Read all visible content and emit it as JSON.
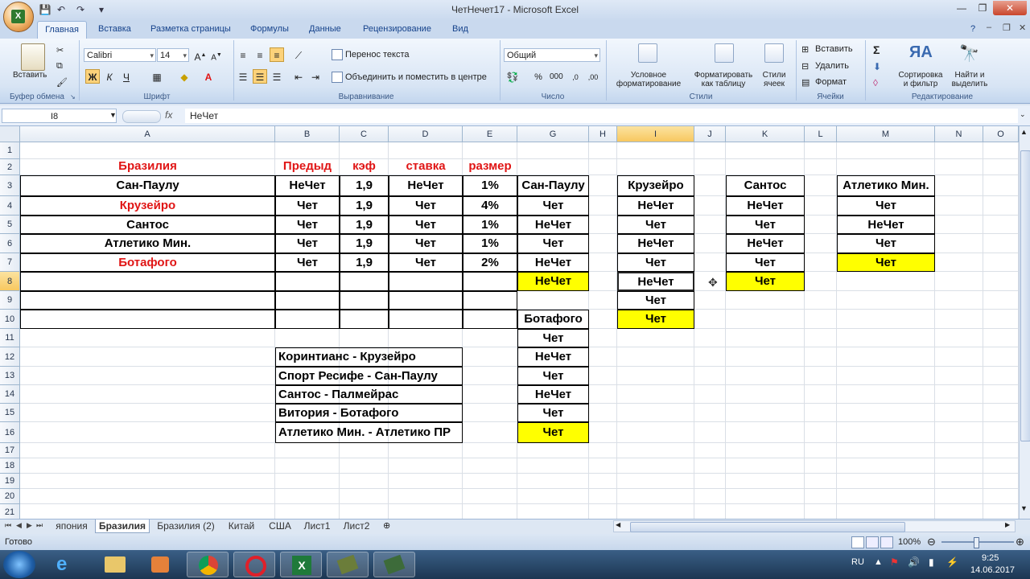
{
  "window": {
    "title": "ЧетНечет17 - Microsoft Excel"
  },
  "tabs": [
    "Главная",
    "Вставка",
    "Разметка страницы",
    "Формулы",
    "Данные",
    "Рецензирование",
    "Вид"
  ],
  "ribbon": {
    "paste_label": "Вставить",
    "font_name": "Calibri",
    "font_size": "14",
    "wrap_text": "Перенос текста",
    "merge_center": "Объединить и поместить в центре",
    "number_format": "Общий",
    "cond_format": [
      "Условное",
      "форматирование"
    ],
    "format_table": [
      "Форматировать",
      "как таблицу"
    ],
    "cell_styles": [
      "Стили",
      "ячеек"
    ],
    "insert": "Вставить",
    "delete": "Удалить",
    "format": "Формат",
    "sort_filter": [
      "Сортировка",
      "и фильтр"
    ],
    "find_select": [
      "Найти и",
      "выделить"
    ],
    "groups": [
      "Буфер обмена",
      "Шрифт",
      "Выравнивание",
      "Число",
      "Стили",
      "Ячейки",
      "Редактирование"
    ]
  },
  "formula_bar": {
    "name_box": "I8",
    "fx": "fx",
    "content": "НеЧет"
  },
  "columns": [
    "A",
    "B",
    "C",
    "D",
    "E",
    "G",
    "H",
    "I",
    "J",
    "K",
    "L",
    "M",
    "N",
    "O"
  ],
  "rows": [
    "1",
    "2",
    "3",
    "4",
    "5",
    "6",
    "7",
    "8",
    "9",
    "10",
    "11",
    "12",
    "13",
    "14",
    "15",
    "16",
    "17",
    "18",
    "19",
    "20",
    "21"
  ],
  "table_main": {
    "headers": [
      "Бразилия",
      "Предыд",
      "кэф",
      "ставка",
      "размер"
    ],
    "rows": [
      [
        "Сан-Паулу",
        "НеЧет",
        "1,9",
        "НеЧет",
        "1%"
      ],
      [
        "Крузейро",
        "Чет",
        "1,9",
        "Чет",
        "4%"
      ],
      [
        "Сантос",
        "Чет",
        "1,9",
        "Чет",
        "1%"
      ],
      [
        "Атлетико Мин.",
        "Чет",
        "1,9",
        "Чет",
        "1%"
      ],
      [
        "Ботафого",
        "Чет",
        "1,9",
        "Чет",
        "2%"
      ]
    ]
  },
  "matches": [
    "Коринтианс - Крузейро",
    "Спорт Ресифе - Сан-Паулу",
    "Сантос - Палмейрас",
    "Витория - Ботафого",
    "Атлетико Мин. - Атлетико ПР"
  ],
  "col_g_top": [
    "Сан-Паулу",
    "Чет",
    "НеЧет",
    "Чет",
    "НеЧет",
    "НеЧет"
  ],
  "col_g_bottom": [
    "Ботафого",
    "Чет",
    "НеЧет",
    "Чет",
    "НеЧет",
    "Чет",
    "Чет"
  ],
  "col_i": [
    "Крузейро",
    "НеЧет",
    "Чет",
    "НеЧет",
    "Чет",
    "НеЧет",
    "Чет",
    "Чет"
  ],
  "col_k": [
    "Сантос",
    "НеЧет",
    "Чет",
    "НеЧет",
    "Чет",
    "Чет"
  ],
  "col_m": [
    "Атлетико Мин.",
    "Чет",
    "НеЧет",
    "Чет",
    "Чет"
  ],
  "sheets": [
    "япония",
    "Бразилия",
    "Бразилия (2)",
    "Китай",
    "США",
    "Лист1",
    "Лист2"
  ],
  "status": {
    "ready": "Готово",
    "zoom": "100%"
  },
  "taskbar": {
    "lang": "RU",
    "time": "9:25",
    "date": "14.06.2017"
  },
  "colors": {
    "highlight": "#ffff00",
    "team_red": "#e01515"
  }
}
